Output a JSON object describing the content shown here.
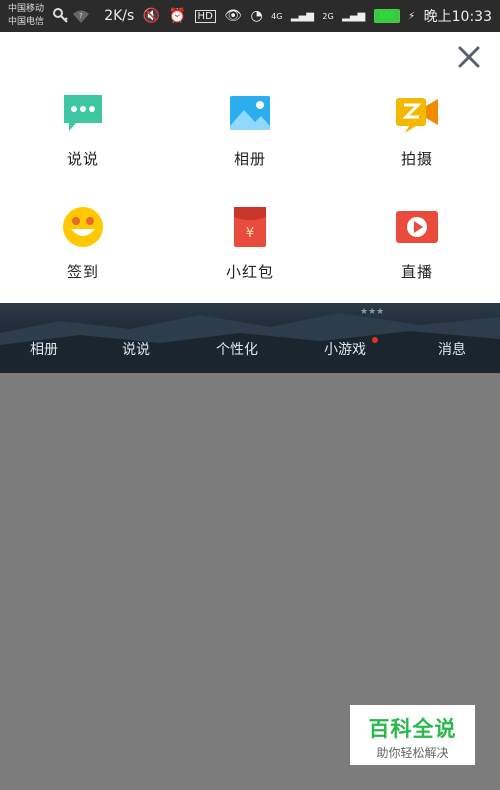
{
  "statusbar": {
    "carrier_1": "中国移动",
    "carrier_2": "中国电信",
    "speed": "2K/s",
    "net_4g": "4G",
    "net_2g": "2G",
    "battery": "100",
    "time": "晚上10:33"
  },
  "sheet": {
    "items": [
      {
        "label": "说说",
        "icon": "speech-bubble-icon",
        "color": "#3ec7a2"
      },
      {
        "label": "相册",
        "icon": "photo-album-icon",
        "color": "#2aaef0"
      },
      {
        "label": "拍摄",
        "icon": "video-camera-icon",
        "color": "#f5b800"
      },
      {
        "label": "签到",
        "icon": "smiley-icon",
        "color": "#ffc800"
      },
      {
        "label": "小红包",
        "icon": "red-packet-icon",
        "color": "#e94b3c"
      },
      {
        "label": "直播",
        "icon": "live-play-icon",
        "color": "#e94b3c"
      }
    ]
  },
  "tabs": [
    "相册",
    "说说",
    "个性化",
    "小游戏",
    "消息"
  ],
  "watermark": {
    "title": "百科全说",
    "subtitle": "助你轻松解决"
  }
}
